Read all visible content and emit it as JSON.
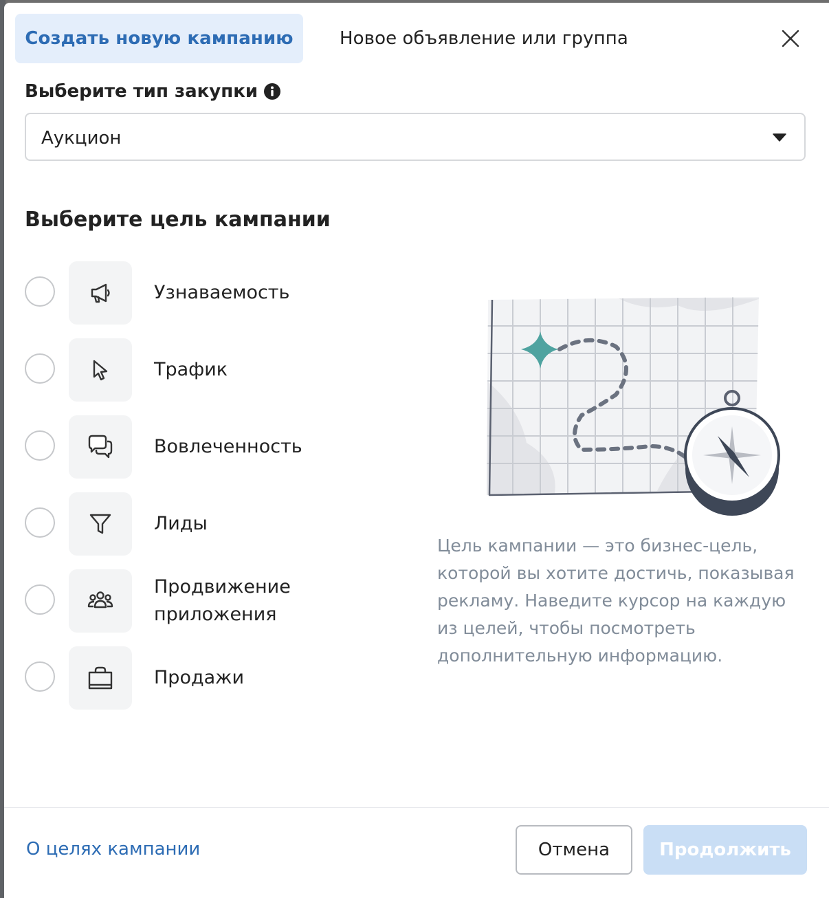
{
  "tabs": {
    "active": "Создать новую кампанию",
    "inactive": "Новое объявление или группа"
  },
  "purchase_type": {
    "label": "Выберите тип закупки",
    "value": "Аукцион"
  },
  "goals_heading": "Выберите цель кампании",
  "goals": [
    {
      "label": "Узнаваемость",
      "icon": "megaphone-icon",
      "selected": false
    },
    {
      "label": "Трафик",
      "icon": "cursor-icon",
      "selected": false
    },
    {
      "label": "Вовлеченность",
      "icon": "chat-bubbles-icon",
      "selected": false
    },
    {
      "label": "Лиды",
      "icon": "funnel-icon",
      "selected": false
    },
    {
      "label": "Продвижение приложения",
      "icon": "users-group-icon",
      "selected": false
    },
    {
      "label": "Продажи",
      "icon": "shopping-bag-icon",
      "selected": false
    }
  ],
  "description": "Цель кампании — это бизнес-цель, которой вы хотите достичь, показывая рекламу. Наведите курсор на каждую из целей, чтобы посмотреть дополнительную информацию.",
  "footer": {
    "link": "О целях кампании",
    "cancel": "Отмена",
    "continue": "Продолжить"
  },
  "colors": {
    "accent": "#2d6cb4",
    "active_tab_bg": "#e4eefb",
    "continue_disabled_bg": "#c9def5",
    "illustration_teal": "#4fa3a0"
  }
}
